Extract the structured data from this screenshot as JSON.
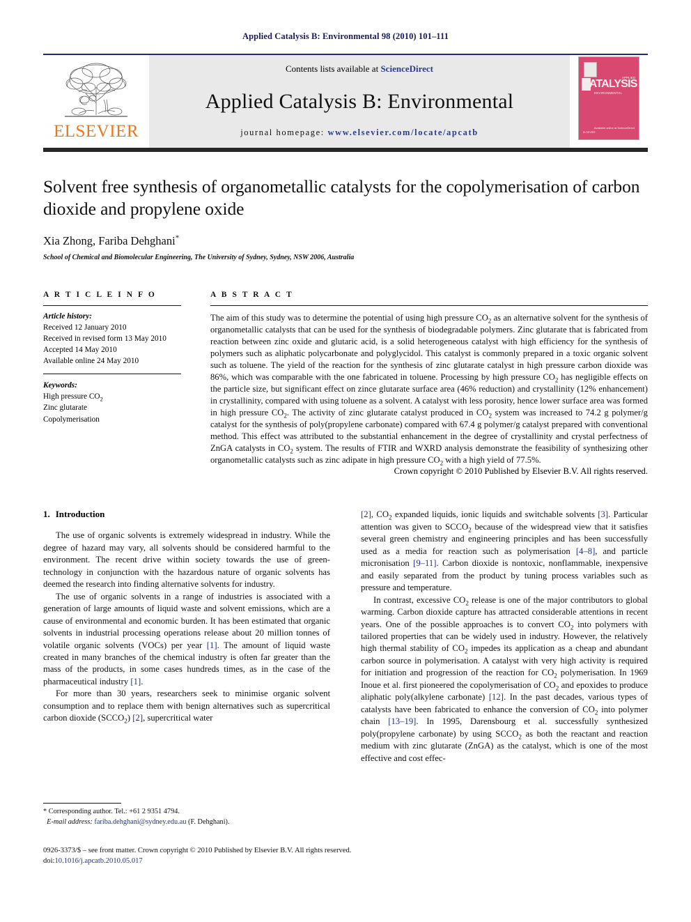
{
  "running_head": "Applied Catalysis B: Environmental 98 (2010) 101–111",
  "masthead": {
    "publisher_name": "ELSEVIER",
    "contents_prefix": "Contents lists available at ",
    "contents_link": "ScienceDirect",
    "journal_title": "Applied Catalysis B: Environmental",
    "homepage_prefix": "journal homepage: ",
    "homepage_url": "www.elsevier.com/locate/apcatb",
    "cover": {
      "title": "CATALYSIS",
      "subtitle": "ENVIRONMENTAL",
      "kicker": "APPLIED",
      "science_direct": "Available online at ScienceDirect",
      "footer": "ELSEVIER"
    }
  },
  "article": {
    "title": "Solvent free synthesis of organometallic catalysts for the copolymerisation of carbon dioxide and propylene oxide",
    "authors": "Xia Zhong, Fariba Dehghani",
    "corresponding_marker": "*",
    "affiliation": "School of Chemical and Biomolecular Engineering, The University of Sydney, Sydney, NSW 2006, Australia"
  },
  "article_info": {
    "heading": "A R T I C L E   I N F O",
    "history_label": "Article history:",
    "history": [
      "Received 12 January 2010",
      "Received in revised form 13 May 2010",
      "Accepted 14 May 2010",
      "Available online 24 May 2010"
    ],
    "keywords_label": "Keywords:",
    "keywords": [
      "High pressure CO2",
      "Zinc glutarate",
      "Copolymerisation"
    ]
  },
  "abstract": {
    "heading": "A B S T R A C T",
    "text": "The aim of this study was to determine the potential of using high pressure CO2 as an alternative solvent for the synthesis of organometallic catalysts that can be used for the synthesis of biodegradable polymers. Zinc glutarate that is fabricated from reaction between zinc oxide and glutaric acid, is a solid heterogeneous catalyst with high efficiency for the synthesis of polymers such as aliphatic polycarbonate and polyglycidol. This catalyst is commonly prepared in a toxic organic solvent such as toluene. The yield of the reaction for the synthesis of zinc glutarate catalyst in high pressure carbon dioxide was 86%, which was comparable with the one fabricated in toluene. Processing by high pressure CO2 has negligible effects on the particle size, but significant effect on zince glutarate surface area (46% reduction) and crystallinity (12% enhancement) in crystallinity, compared with using toluene as a solvent. A catalyst with less porosity, hence lower surface area was formed in high pressure CO2. The activity of zinc glutarate catalyst produced in CO2 system was increased to 74.2 g polymer/g catalyst for the synthesis of poly(propylene carbonate) compared with 67.4 g polymer/g catalyst prepared with conventional method. This effect was attributed to the substantial enhancement in the degree of crystallinity and crystal perfectness of ZnGA catalysts in CO2 system. The results of FTIR and WXRD analysis demonstrate the feasibility of synthesizing other organometallic catalysts such as zinc adipate in high pressure CO2 with a high yield of 77.5%.",
    "copyright": "Crown copyright © 2010 Published by Elsevier B.V. All rights reserved."
  },
  "body": {
    "section_number": "1.",
    "section_title": "Introduction",
    "left_paragraphs": [
      "The use of organic solvents is extremely widespread in industry. While the degree of hazard may vary, all solvents should be considered harmful to the environment. The recent drive within society towards the use of green-technology in conjunction with the hazardous nature of organic solvents has deemed the research into finding alternative solvents for industry.",
      "The use of organic solvents in a range of industries is associated with a generation of large amounts of liquid waste and solvent emissions, which are a cause of environmental and economic burden. It has been estimated that organic solvents in industrial processing operations release about 20 million tonnes of volatile organic solvents (VOCs) per year [1]. The amount of liquid waste created in many branches of the chemical industry is often far greater than the mass of the products, in some cases hundreds times, as in the case of the pharmaceutical industry [1].",
      "For more than 30 years, researchers seek to minimise organic solvent consumption and to replace them with benign alternatives such as supercritical carbon dioxide (SCCO2) [2], supercritical water"
    ],
    "right_paragraphs": [
      "[2], CO2 expanded liquids, ionic liquids and switchable solvents [3]. Particular attention was given to SCCO2 because of the widespread view that it satisfies several green chemistry and engineering principles and has been successfully used as a media for reaction such as polymerisation [4–8], and particle micronisation [9–11]. Carbon dioxide is nontoxic, nonflammable, inexpensive and easily separated from the product by tuning process variables such as pressure and temperature.",
      "In contrast, excessive CO2 release is one of the major contributors to global warming. Carbon dioxide capture has attracted considerable attentions in recent years. One of the possible approaches is to convert CO2 into polymers with tailored properties that can be widely used in industry. However, the relatively high thermal stability of CO2 impedes its application as a cheap and abundant carbon source in polymerisation. A catalyst with very high activity is required for initiation and progression of the reaction for CO2 polymerisation. In 1969 Inoue et al. first pioneered the copolymerisation of CO2 and epoxides to produce aliphatic poly(alkylene carbonate) [12]. In the past decades, various types of catalysts have been fabricated to enhance the conversion of CO2 into polymer chain [13–19]. In 1995, Darensbourg et al. successfully synthesized poly(propylene carbonate) by using SCCO2 as both the reactant and reaction medium with zinc glutarate (ZnGA) as the catalyst, which is one of the most effective and cost effec-"
    ]
  },
  "footnotes": {
    "corresponding": "* Corresponding author. Tel.: +61 2 9351 4794.",
    "email_label": "E-mail address:",
    "email": "fariba.dehghani@sydney.edu.au",
    "email_suffix": "(F. Dehghani)."
  },
  "footer": {
    "issn_line": "0926-3373/$ – see front matter. Crown copyright © 2010 Published by Elsevier B.V. All rights reserved.",
    "doi_prefix": "doi:",
    "doi": "10.1016/j.apcatb.2010.05.017"
  }
}
